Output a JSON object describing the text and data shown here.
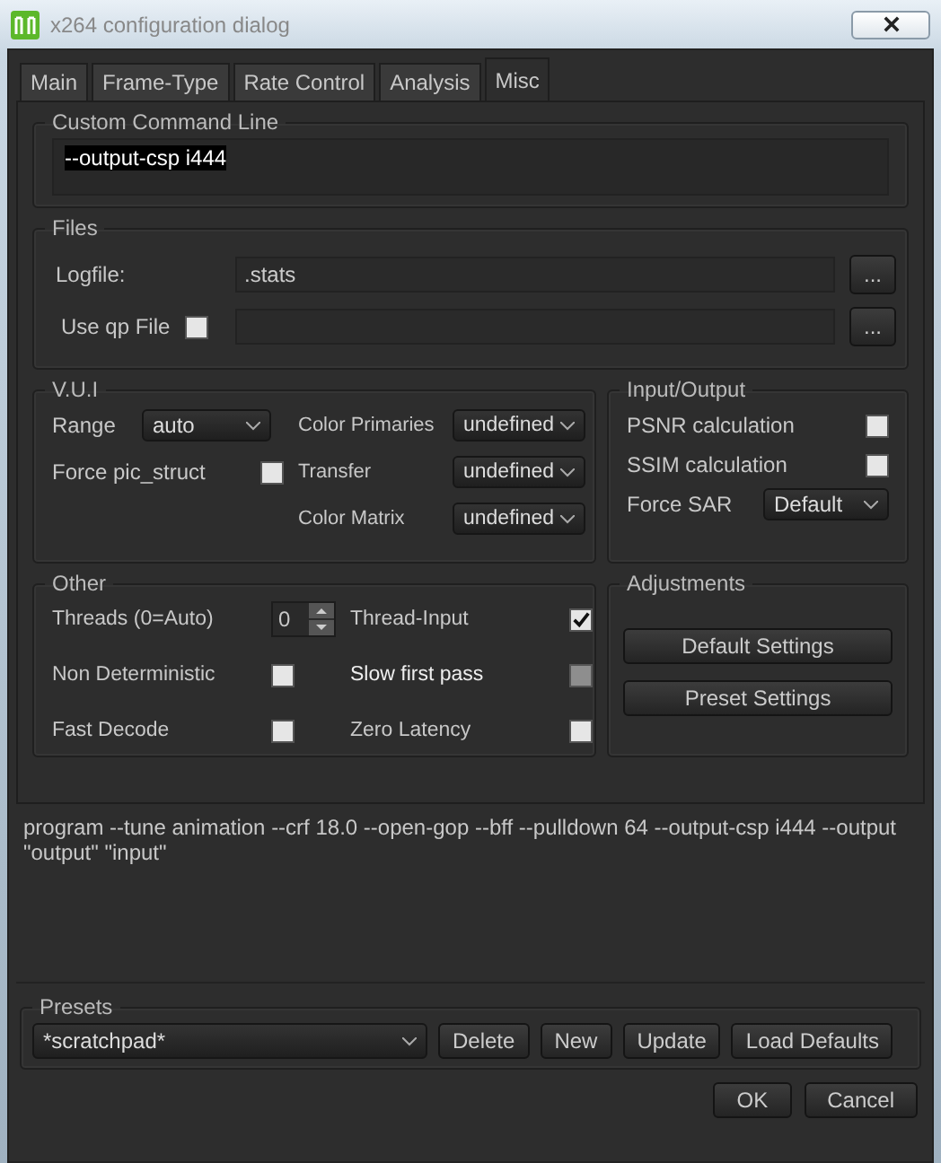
{
  "window": {
    "title": "x264 configuration dialog"
  },
  "tabs": [
    {
      "label": "Main",
      "selected": false
    },
    {
      "label": "Frame-Type",
      "selected": false
    },
    {
      "label": "Rate Control",
      "selected": false
    },
    {
      "label": "Analysis",
      "selected": false
    },
    {
      "label": "Misc",
      "selected": true
    }
  ],
  "custom_command_line": {
    "title": "Custom Command Line",
    "value": "--output-csp i444"
  },
  "files": {
    "title": "Files",
    "logfile": {
      "label": "Logfile:",
      "value": ".stats",
      "browse": "..."
    },
    "qp_file": {
      "label": "Use qp File",
      "checked": false,
      "browse": "..."
    }
  },
  "vui": {
    "title": "V.U.I",
    "range": {
      "label": "Range",
      "value": "auto"
    },
    "force_pic_struct": {
      "label": "Force pic_struct",
      "checked": false
    },
    "dropdowns": [
      {
        "label": "Color Primaries",
        "value": "undefined"
      },
      {
        "label": "Transfer",
        "value": "undefined"
      },
      {
        "label": "Color Matrix",
        "value": "undefined"
      }
    ]
  },
  "input_output": {
    "title": "Input/Output",
    "checks": [
      {
        "label": "PSNR calculation",
        "checked": false
      },
      {
        "label": "SSIM calculation",
        "checked": false
      }
    ],
    "force_sar": {
      "label": "Force SAR",
      "value": "Default"
    }
  },
  "other": {
    "title": "Other",
    "threads": {
      "label": "Threads (0=Auto)",
      "value": "0"
    },
    "left_checks": [
      {
        "label": "Non Deterministic",
        "checked": false,
        "disabled": false
      },
      {
        "label": "Fast Decode",
        "checked": false,
        "disabled": false
      }
    ],
    "right_checks": [
      {
        "label": "Thread-Input",
        "checked": true,
        "disabled": false
      },
      {
        "label": "Slow first pass",
        "checked": false,
        "disabled": true
      },
      {
        "label": "Zero Latency",
        "checked": false,
        "disabled": false
      }
    ]
  },
  "adjustments": {
    "title": "Adjustments",
    "buttons": [
      "Default Settings",
      "Preset Settings"
    ]
  },
  "command_preview": "program --tune animation --crf 18.0 --open-gop --bff --pulldown 64 --output-csp i444 --output \"output\" \"input\"",
  "presets": {
    "title": "Presets",
    "value": "*scratchpad*",
    "buttons": [
      "Delete",
      "New",
      "Update",
      "Load Defaults"
    ]
  },
  "dialog_buttons": [
    "OK",
    "Cancel"
  ]
}
